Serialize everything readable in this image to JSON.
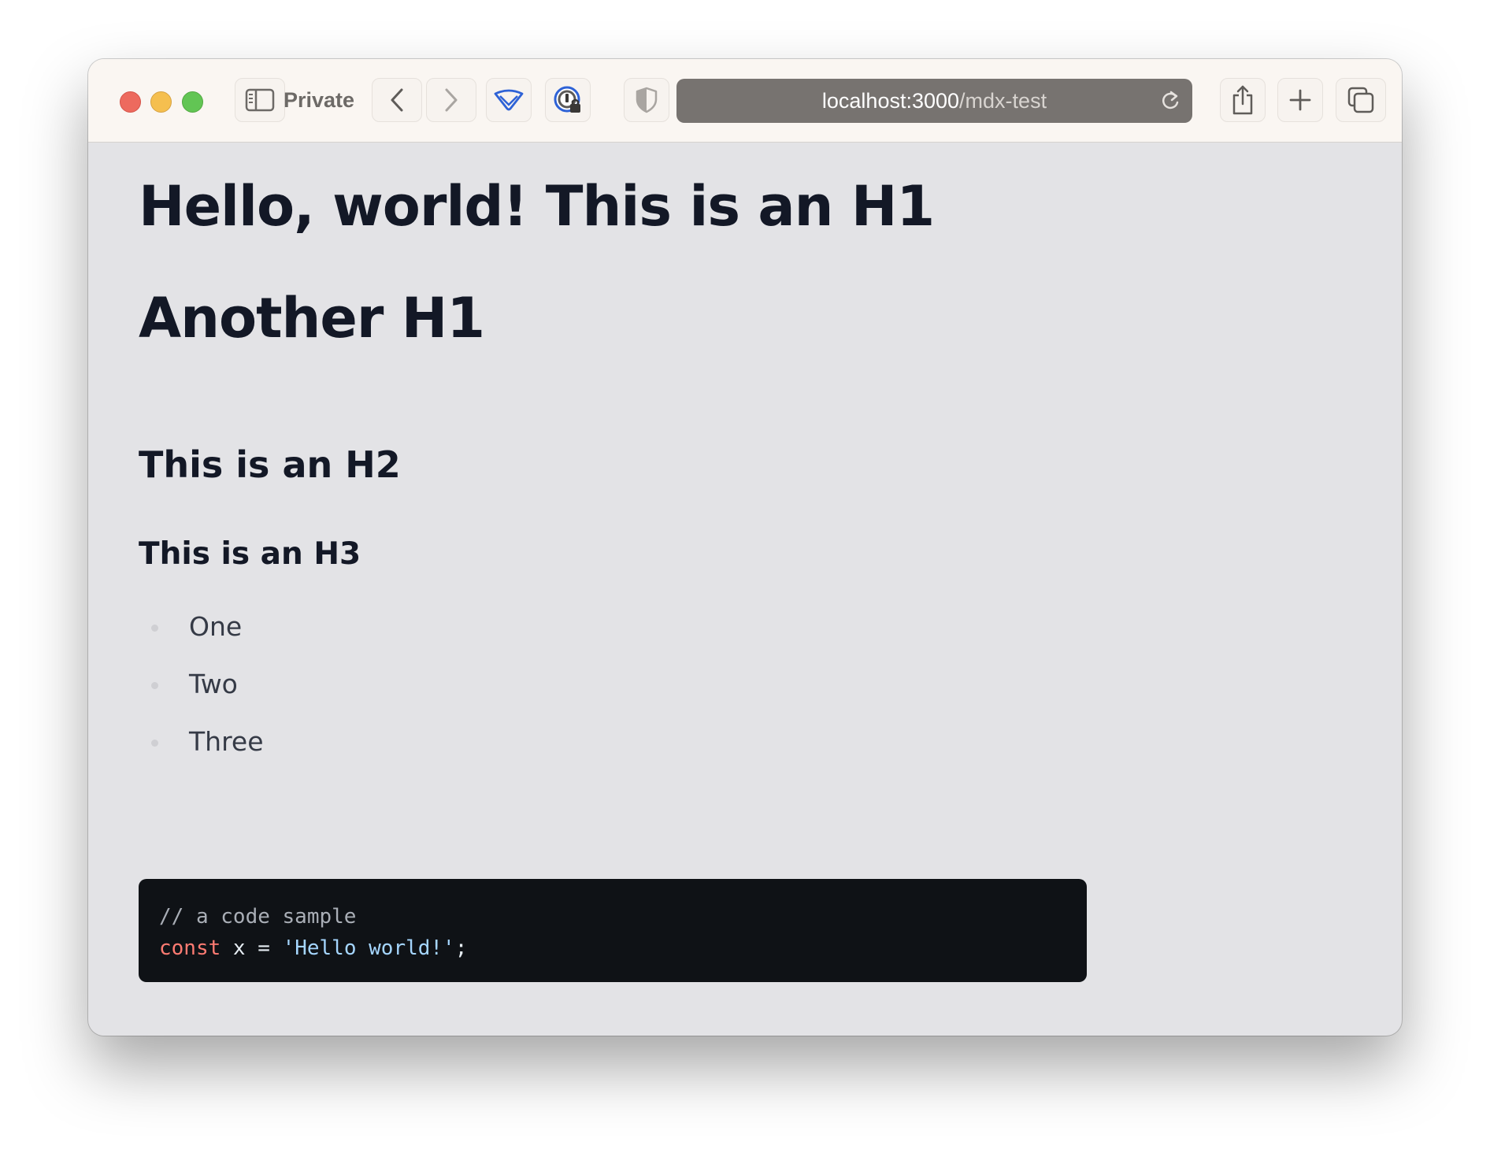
{
  "browser": {
    "private_label": "Private",
    "url_host": "localhost:3000",
    "url_path": "/mdx-test",
    "icons": [
      "sidebar-icon",
      "back-icon",
      "forward-icon",
      "wipr-icon",
      "onepassword-icon",
      "privacy-shield-icon",
      "reload-icon",
      "share-icon",
      "new-tab-icon",
      "tab-overview-icon"
    ]
  },
  "page": {
    "h1_first": "Hello, world! This is an H1",
    "h1_second": "Another H1",
    "h2": "This is an H2",
    "h3": "This is an H3",
    "list": [
      "One",
      "Two",
      "Three"
    ],
    "code": {
      "comment": "// a code sample",
      "keyword": "const",
      "identifier": " x = ",
      "string": "'Hello world!'",
      "terminator": ";"
    }
  },
  "colors": {
    "page_background": "#e3e3e6",
    "heading_text": "#131826",
    "code_background": "#0f1216",
    "code_keyword": "#ff7b72",
    "code_string": "#a5d6ff"
  }
}
